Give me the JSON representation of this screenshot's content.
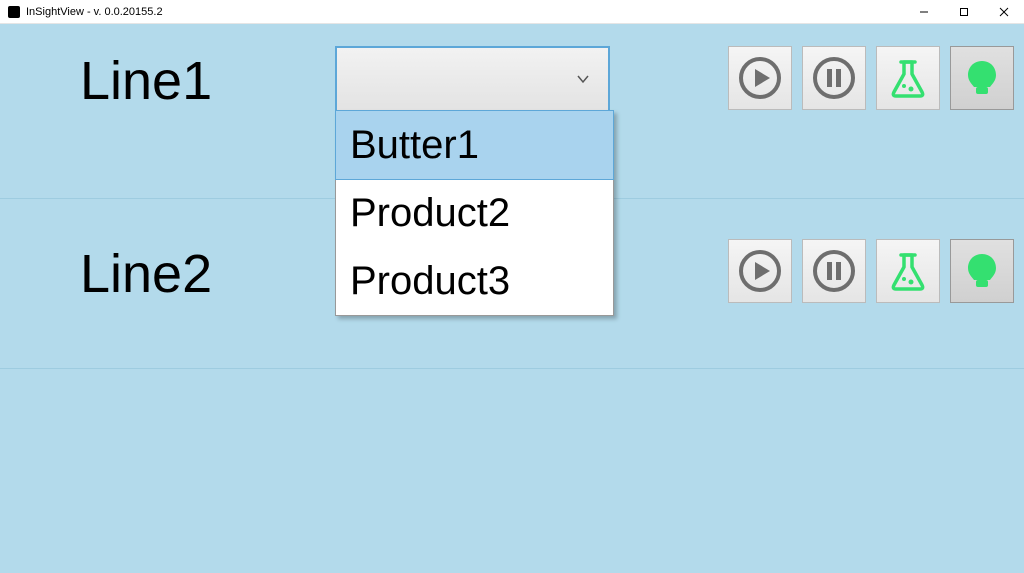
{
  "window": {
    "title": "InSightView - v. 0.0.20155.2"
  },
  "rows": [
    {
      "label": "Line1",
      "dropdown": {
        "selected": "",
        "open": true,
        "options": [
          "Butter1",
          "Product2",
          "Product3"
        ],
        "highlighted_index": 0
      }
    },
    {
      "label": "Line2",
      "dropdown": {
        "selected": "",
        "open": false,
        "options": []
      }
    }
  ],
  "colors": {
    "background": "#b3daeb",
    "icon_gray": "#6e6e6e",
    "icon_green": "#34e070"
  }
}
